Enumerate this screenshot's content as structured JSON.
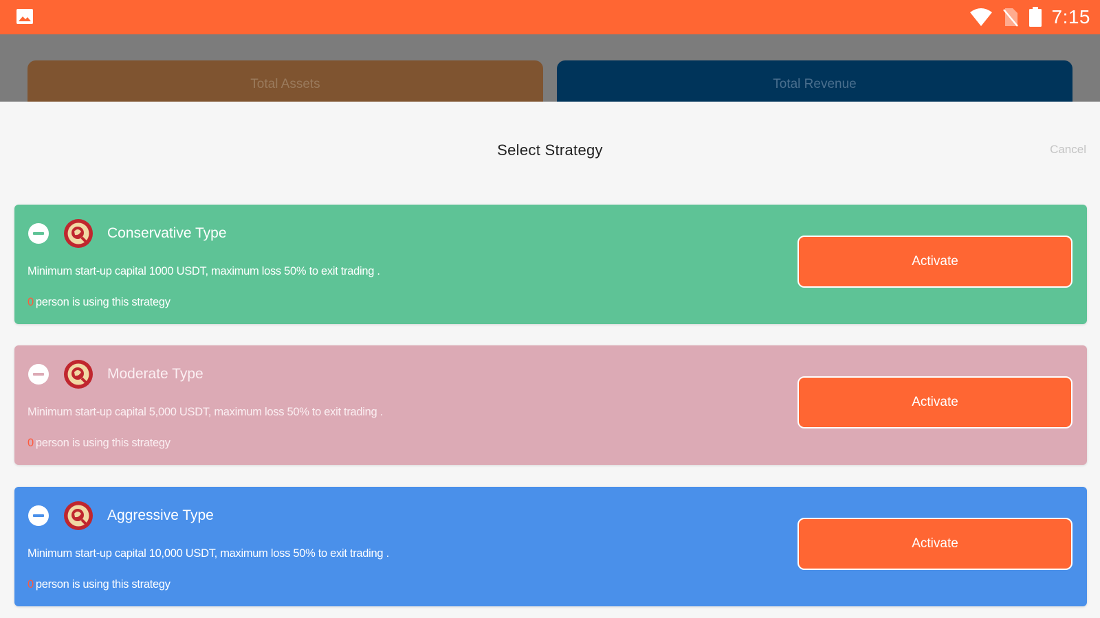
{
  "status_bar": {
    "time": "7:15",
    "icons": [
      "gallery-icon",
      "wifi-icon",
      "no-sim-icon",
      "battery-icon"
    ],
    "background": "#ff6633"
  },
  "background_cards": {
    "total_assets": "Total Assets",
    "total_revenue": "Total Revenue"
  },
  "sheet": {
    "title": "Select Strategy",
    "cancel_label": "Cancel"
  },
  "strategies": [
    {
      "title": "Conservative Type",
      "description": "Minimum start-up capital 1000 USDT, maximum loss 50% to exit trading .",
      "user_count": "0",
      "users_text": "person is using this strategy",
      "button_label": "Activate",
      "color": "#5ec396"
    },
    {
      "title": "Moderate Type",
      "description": "Minimum start-up capital 5,000 USDT, maximum loss 50% to exit trading .",
      "user_count": "0",
      "users_text": "person is using this strategy",
      "button_label": "Activate",
      "color": "#dcaab5"
    },
    {
      "title": "Aggressive Type",
      "description": "Minimum start-up capital 10,000 USDT, maximum loss 50% to exit trading .",
      "user_count": "0",
      "users_text": "person is using this strategy",
      "button_label": "Activate",
      "color": "#4a90ea"
    }
  ],
  "accent_colors": {
    "orange": "#ff6633",
    "count_red": "#ff5a3c"
  }
}
